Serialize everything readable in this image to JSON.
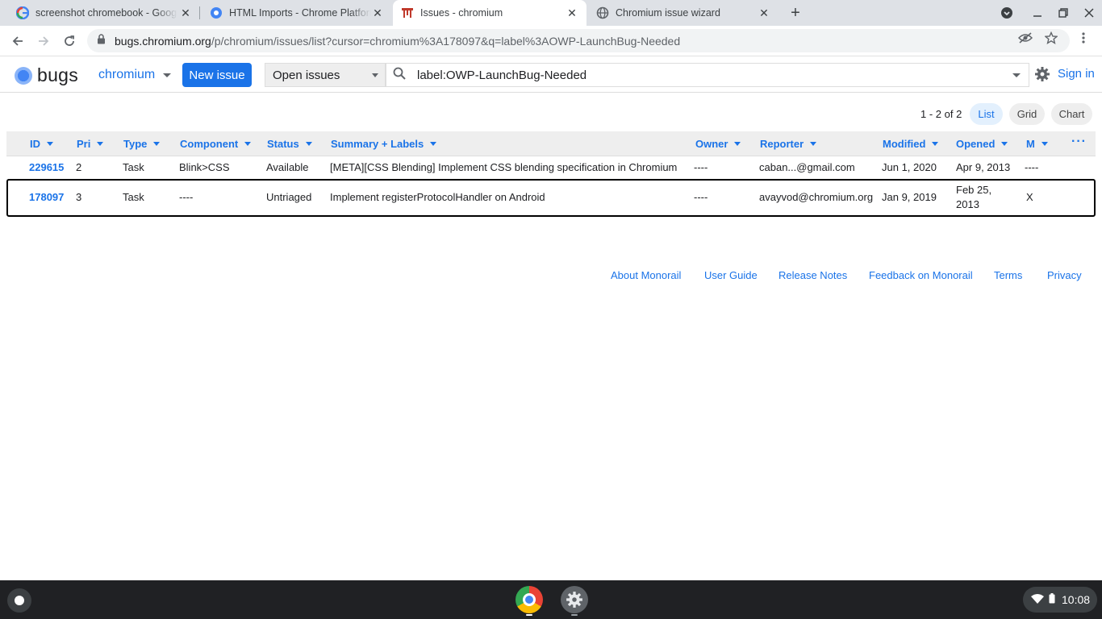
{
  "browser": {
    "tabs": [
      {
        "title": "screenshot chromebook - Google Search",
        "active": false
      },
      {
        "title": "HTML Imports - Chrome Platform Status",
        "active": false
      },
      {
        "title": "Issues - chromium",
        "active": true
      },
      {
        "title": "Chromium issue wizard",
        "active": false
      }
    ],
    "url_host": "bugs.chromium.org",
    "url_path": "/p/chromium/issues/list?cursor=chromium%3A178097&q=label%3AOWP-LaunchBug-Needed"
  },
  "app": {
    "logo_text": "bugs",
    "project": "chromium",
    "new_issue_label": "New issue",
    "can_select": "Open issues",
    "search_query": "label:OWP-LaunchBug-Needed",
    "sign_in": "Sign in"
  },
  "list": {
    "pager": "1 - 2 of 2",
    "views": [
      "List",
      "Grid",
      "Chart"
    ],
    "active_view": "List",
    "columns": [
      "ID",
      "Pri",
      "Type",
      "Component",
      "Status",
      "Summary + Labels",
      "Owner",
      "Reporter",
      "Modified",
      "Opened",
      "M"
    ],
    "rows": [
      {
        "id": "229615",
        "pri": "2",
        "type": "Task",
        "component": "Blink>CSS",
        "status": "Available",
        "summary": "[META][CSS Blending] Implement CSS blending specification in Chromium",
        "owner": "----",
        "reporter": "caban...@gmail.com",
        "modified": "Jun 1, 2020",
        "opened": "Apr 9, 2013",
        "m": "----"
      },
      {
        "id": "178097",
        "pri": "3",
        "type": "Task",
        "component": "----",
        "status": "Untriaged",
        "summary": "Implement registerProtocolHandler on Android",
        "owner": "----",
        "reporter": "avayvod@chromium.org",
        "modified": "Jan 9, 2019",
        "opened_line1": "Feb 25,",
        "opened_line2": "2013",
        "m": "X"
      }
    ]
  },
  "footer": {
    "links": [
      "About Monorail",
      "User Guide",
      "Release Notes",
      "Feedback on Monorail",
      "Terms",
      "Privacy"
    ]
  },
  "shelf": {
    "time": "10:08"
  },
  "colors": {
    "accent": "#1a73e8",
    "tabstrip": "#dee1e6",
    "shelf": "#202124"
  }
}
